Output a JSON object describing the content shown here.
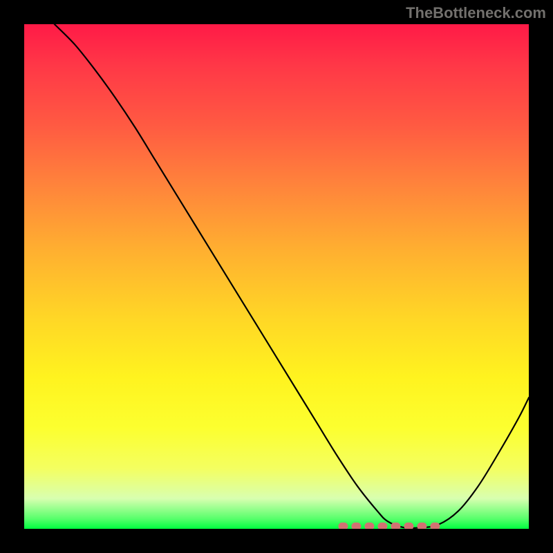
{
  "watermark": "TheBottleneck.com",
  "chart_data": {
    "type": "line",
    "title": "",
    "xlabel": "",
    "ylabel": "",
    "xlim": [
      0,
      100
    ],
    "ylim": [
      0,
      100
    ],
    "grid": false,
    "series": [
      {
        "name": "curve",
        "color": "#000000",
        "x": [
          6,
          10,
          14,
          18,
          22,
          26,
          30,
          34,
          38,
          42,
          46,
          50,
          54,
          58,
          62,
          66,
          70,
          72,
          75,
          78,
          82,
          86,
          90,
          94,
          98,
          100
        ],
        "y": [
          100,
          96,
          91,
          85.5,
          79.5,
          73,
          66.5,
          60,
          53.5,
          47,
          40.5,
          34,
          27.5,
          21,
          14.5,
          8.5,
          3.5,
          1.5,
          0.3,
          0.2,
          0.8,
          3.5,
          8.5,
          15,
          22,
          26
        ]
      }
    ],
    "highlight_band": {
      "name": "optimal-range",
      "color": "#d17272",
      "x_start": 63,
      "x_end": 82,
      "y": 0.5
    }
  }
}
